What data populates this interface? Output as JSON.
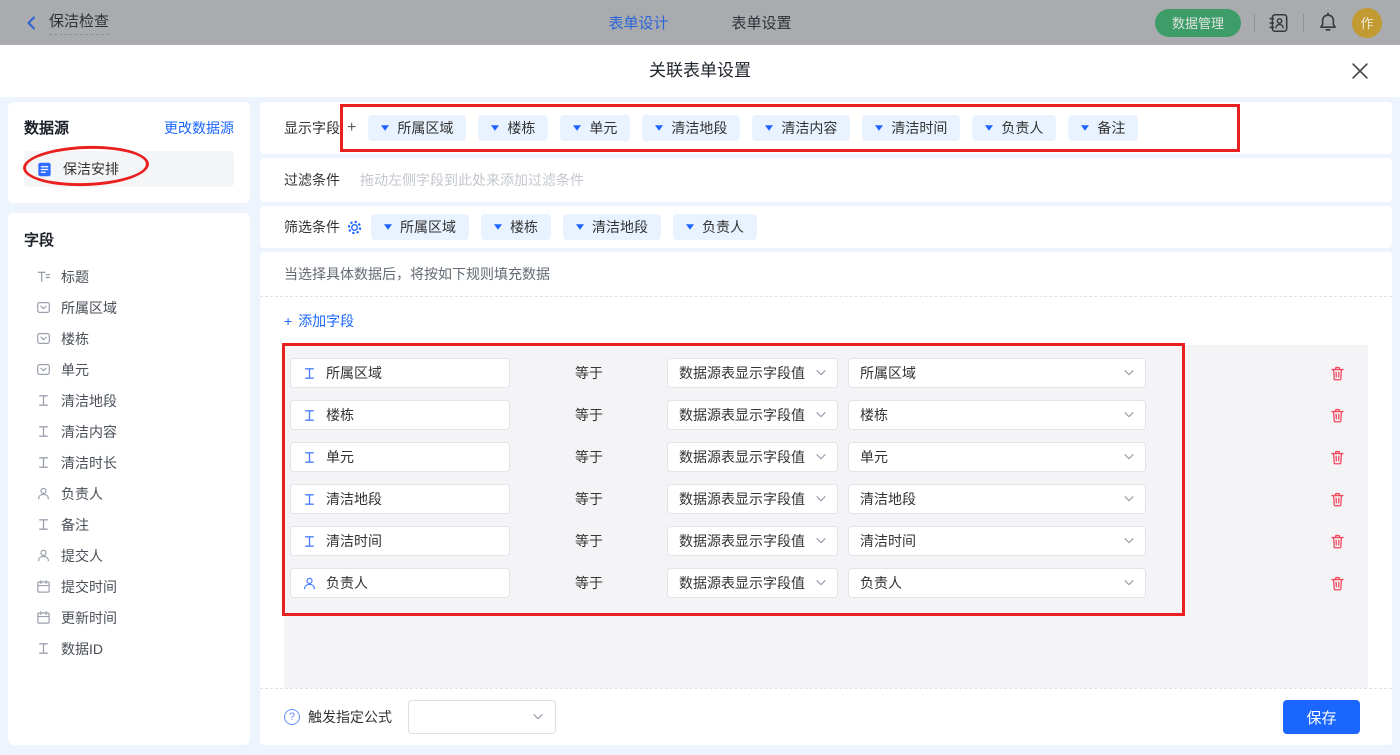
{
  "topbar": {
    "back_label": "保洁检查",
    "tabs": [
      {
        "label": "表单设计",
        "active": true
      },
      {
        "label": "表单设置",
        "active": false
      }
    ],
    "data_manage_button": "数据管理",
    "avatar_text": "作"
  },
  "modal": {
    "title": "关联表单设置"
  },
  "sidebar": {
    "datasource": {
      "heading": "数据源",
      "change_link": "更改数据源",
      "item": {
        "label": "保洁安排",
        "icon": "form-doc-icon"
      }
    },
    "fields": {
      "heading": "字段",
      "items": [
        {
          "label": "标题",
          "type": "title"
        },
        {
          "label": "所属区域",
          "type": "select"
        },
        {
          "label": "楼栋",
          "type": "select"
        },
        {
          "label": "单元",
          "type": "select"
        },
        {
          "label": "清洁地段",
          "type": "text"
        },
        {
          "label": "清洁内容",
          "type": "text"
        },
        {
          "label": "清洁时长",
          "type": "text"
        },
        {
          "label": "负责人",
          "type": "person"
        },
        {
          "label": "备注",
          "type": "text"
        },
        {
          "label": "提交人",
          "type": "person"
        },
        {
          "label": "提交时间",
          "type": "date"
        },
        {
          "label": "更新时间",
          "type": "date"
        },
        {
          "label": "数据ID",
          "type": "text"
        }
      ]
    }
  },
  "main": {
    "display_fields": {
      "label": "显示字段",
      "add_symbol": "+",
      "chips": [
        "所属区域",
        "楼栋",
        "单元",
        "清洁地段",
        "清洁内容",
        "清洁时间",
        "负责人",
        "备注"
      ]
    },
    "filter": {
      "label": "过滤条件",
      "placeholder": "拖动左侧字段到此处来添加过滤条件"
    },
    "screen": {
      "label": "筛选条件",
      "chips": [
        "所属区域",
        "楼栋",
        "清洁地段",
        "负责人"
      ]
    },
    "rules": {
      "hint": "当选择具体数据后，将按如下规则填充数据",
      "add_plus": "+",
      "add_field": "添加字段",
      "rows": [
        {
          "field": "所属区域",
          "type": "text",
          "operator": "等于",
          "source": "数据源表显示字段值",
          "target": "所属区域"
        },
        {
          "field": "楼栋",
          "type": "text",
          "operator": "等于",
          "source": "数据源表显示字段值",
          "target": "楼栋"
        },
        {
          "field": "单元",
          "type": "text",
          "operator": "等于",
          "source": "数据源表显示字段值",
          "target": "单元"
        },
        {
          "field": "清洁地段",
          "type": "text",
          "operator": "等于",
          "source": "数据源表显示字段值",
          "target": "清洁地段"
        },
        {
          "field": "清洁时间",
          "type": "text",
          "operator": "等于",
          "source": "数据源表显示字段值",
          "target": "清洁时间"
        },
        {
          "field": "负责人",
          "type": "person",
          "operator": "等于",
          "source": "数据源表显示字段值",
          "target": "负责人"
        }
      ]
    },
    "footer": {
      "help_symbol": "?",
      "formula_label": "触发指定公式",
      "formula_value": "",
      "save_button": "保存"
    }
  },
  "colors": {
    "accent_blue": "#1b66ff",
    "chip_bg": "#e9f2ff",
    "danger_red": "#f5465d",
    "annotation_red": "#e9201f",
    "green_button": "#3e9c68",
    "avatar_gold": "#c19b31",
    "modal_body_bg": "#edf4fd",
    "rules_bg": "#f4f4f6"
  }
}
